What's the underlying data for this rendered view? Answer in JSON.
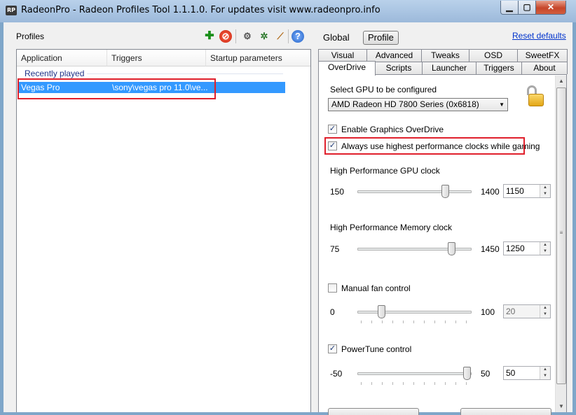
{
  "window": {
    "title": "RadeonPro - Radeon Profiles Tool 1.1.1.0. For updates visit www.radeonpro.info",
    "app_icon": "RP",
    "min_icon": "minimize-icon",
    "max_icon": "maximize-icon",
    "close_icon": "close-icon"
  },
  "profiles": {
    "label": "Profiles",
    "toolbar_icons": [
      "add-profile-icon",
      "delete-profile-icon",
      "settings-icon",
      "gear-icon",
      "broom-icon",
      "help-icon"
    ],
    "columns": [
      "Application",
      "Triggers",
      "Startup parameters"
    ],
    "group": "Recently played",
    "rows": [
      {
        "application": "Vegas Pro",
        "triggers": "\\sony\\vegas pro 11.0\\ve..."
      }
    ]
  },
  "header": {
    "global": "Global",
    "profile": "Profile",
    "reset": "Reset defaults"
  },
  "tabs": {
    "row1": [
      "Visual",
      "Advanced",
      "Tweaks",
      "OSD",
      "SweetFX"
    ],
    "row2": [
      "OverDrive",
      "Scripts",
      "Launcher",
      "Triggers",
      "About"
    ],
    "active": "OverDrive"
  },
  "overdrive": {
    "select_gpu_label": "Select GPU to be configured",
    "gpu_selected": "AMD Radeon HD 7800 Series (0x6818)",
    "lock_icon": "unlocked-padlock-icon",
    "enable_overdrive": {
      "label": "Enable Graphics OverDrive",
      "checked": true
    },
    "always_highest": {
      "label": "Always use highest performance clocks while gaming",
      "checked": true
    },
    "gpu_clock": {
      "label": "High Performance GPU clock",
      "min": "150",
      "max": "1400",
      "value": "1150",
      "min_num": 150,
      "max_num": 1400,
      "value_num": 1150
    },
    "mem_clock": {
      "label": "High Performance Memory clock",
      "min": "75",
      "max": "1450",
      "value": "1250",
      "min_num": 75,
      "max_num": 1450,
      "value_num": 1250
    },
    "fan": {
      "label": "Manual fan control",
      "checked": false,
      "min": "0",
      "max": "100",
      "value": "20",
      "min_num": 0,
      "max_num": 100,
      "value_num": 20
    },
    "powertune": {
      "label": "PowerTune control",
      "checked": true,
      "min": "-50",
      "max": "50",
      "value": "50",
      "min_num": -50,
      "max_num": 50,
      "value_num": 50
    }
  },
  "colors": {
    "selection": "#3399ff",
    "highlight_box": "#e0202c",
    "link": "#0033cc",
    "group_text": "#1e3287"
  }
}
